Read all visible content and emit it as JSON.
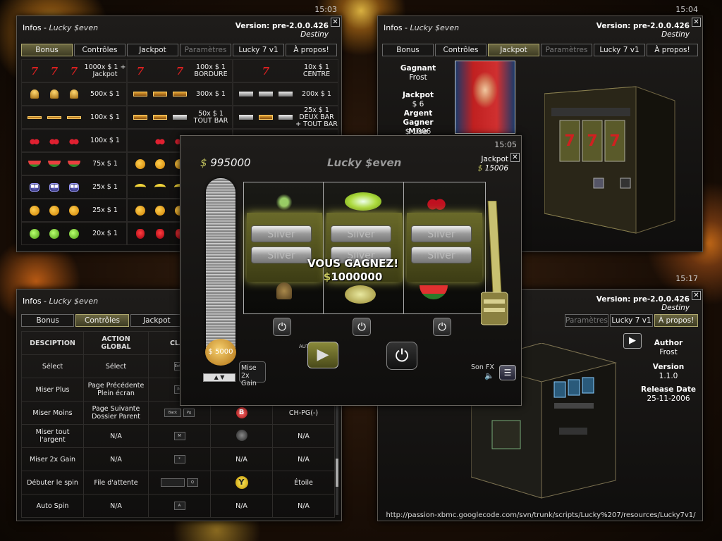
{
  "win_bonus": {
    "clock": "15:03",
    "title_prefix": "Infos - ",
    "title_app": "Lucky $even",
    "version": "Version: pre-2.0.0.426",
    "author": "Destiny",
    "tabs": [
      "Bonus",
      "Contrôles",
      "Jackpot",
      "Paramètres",
      "Lucky 7 v1",
      "À propos!"
    ],
    "cells": [
      "1000x $ 1 + Jackpot",
      "100x $ 1 BORDURE",
      "10x $ 1 CENTRE",
      "500x $ 1",
      "300x $ 1",
      "200x $ 1",
      "100x $ 1",
      "50x $ 1 TOUT BAR",
      "25x $ 1 DEUX BAR + TOUT BAR",
      "100x $ 1",
      "",
      "",
      "75x $ 1",
      "",
      "",
      "25x $ 1",
      "",
      "",
      "25x $ 1",
      "",
      "",
      "20x $ 1",
      "",
      ""
    ]
  },
  "win_jackpot": {
    "clock": "15:04",
    "title_prefix": "Infos - ",
    "title_app": "Lucky $even",
    "version": "Version: pre-2.0.0.426",
    "author": "Destiny",
    "tabs": [
      "Bonus",
      "Contrôles",
      "Jackpot",
      "Paramètres",
      "Lucky 7 v1",
      "À propos!"
    ],
    "winner_label": "Gagnant",
    "winner_value": "Frost",
    "jackpot_label": "Jackpot",
    "jackpot_value": "$ 6",
    "money_label": "Argent Gagner",
    "money_value": "$ 1006",
    "bet_label": "Mise"
  },
  "win_controls": {
    "title_prefix": "Infos - ",
    "title_app": "Lucky $even",
    "tabs": [
      "Bonus",
      "Contrôles",
      "Jackpot"
    ],
    "headers": [
      "DESCIPTION",
      "ACTION GLOBAL",
      "CLAV"
    ],
    "rows": [
      {
        "desc": "Sélect",
        "action": "Sélect",
        "pad": "",
        "remote": ""
      },
      {
        "desc": "Miser Plus",
        "action": "Page Précédente Plein écran",
        "pad": "",
        "remote": ""
      },
      {
        "desc": "Miser Moins",
        "action": "Page Suivante Dossier Parent",
        "pad": "B",
        "remote": "CH-PG(-)"
      },
      {
        "desc": "Miser tout l'argent",
        "action": "N/A",
        "pad": "",
        "remote": "N/A"
      },
      {
        "desc": "Miser 2x Gain",
        "action": "N/A",
        "pad": "N/A",
        "remote": "N/A"
      },
      {
        "desc": "Débuter le spin",
        "action": "File d'attente",
        "pad": "Y",
        "remote": "Étoile"
      },
      {
        "desc": "Auto Spin",
        "action": "N/A",
        "pad": "N/A",
        "remote": "N/A"
      }
    ]
  },
  "win_about": {
    "clock": "15:17",
    "version": "Version: pre-2.0.0.426",
    "author": "Destiny",
    "tabs": [
      "Paramètres",
      "Lucky 7 v1",
      "À propos!"
    ],
    "author_label": "Author",
    "author_value": "Frost",
    "version_label": "Version",
    "version_value": "1.1.0",
    "release_label": "Release Date",
    "release_value": "25-11-2006",
    "url": "http://passion-xbmc.googlecode.com/svn/trunk/scripts/Lucky%207/resources/Lucky7v1/"
  },
  "main": {
    "clock": "15:05",
    "balance": "995000",
    "currency": "$",
    "title": "Lucky $even",
    "jackpot_label": "Jackpot",
    "jackpot_value": "15006",
    "reel_label": "Silver",
    "win_line1": "VOUS GAGNEZ!",
    "win_amount": "1000000",
    "coin_value": "$ 5000",
    "mise_label": "Mise 2x Gain",
    "auto_label": "AUTO",
    "sound_label": "Son FX"
  }
}
